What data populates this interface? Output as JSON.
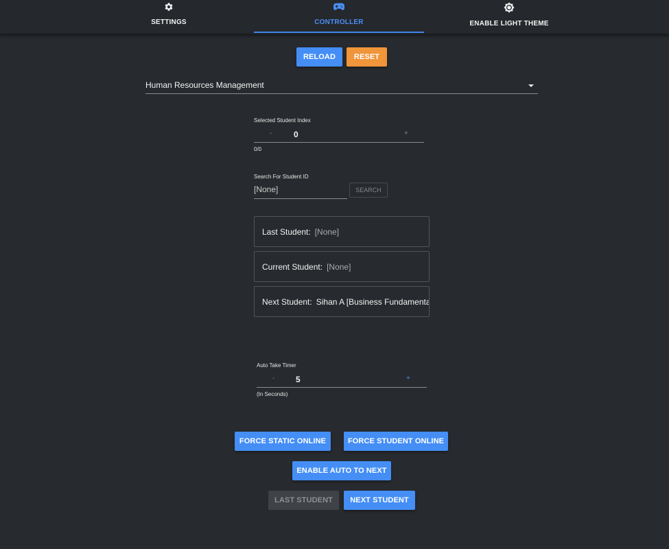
{
  "tabs": [
    {
      "label": "SETTINGS",
      "icon": "gear-icon"
    },
    {
      "label": "CONTROLLER",
      "icon": "gamepad-icon",
      "active": true
    },
    {
      "label": "ENABLE LIGHT THEME",
      "icon": "brightness-icon"
    }
  ],
  "toolbar": {
    "reload_label": "RELOAD",
    "reset_label": "RESET"
  },
  "program_select": {
    "value": "Human Resources Management"
  },
  "student_index": {
    "label": "Selected Student Index",
    "minus": "-",
    "value": "0",
    "plus": "+",
    "count_text": "0/0"
  },
  "search": {
    "label": "Search For Student ID",
    "value": "[None]",
    "button_label": "SEARCH"
  },
  "students": {
    "last_label": "Last Student:",
    "last_value": "[None]",
    "current_label": "Current Student:",
    "current_value": "[None]",
    "next_label": "Next Student:",
    "next_value": "Sihan A [Business Fundamentals]"
  },
  "auto_timer": {
    "label": "Auto Take Timer",
    "minus": "-",
    "value": "5",
    "plus": "+",
    "unit_text": "(In Seconds)"
  },
  "actions": {
    "force_static_label": "FORCE STATIC ONLINE",
    "force_student_label": "FORCE STUDENT ONLINE",
    "auto_next_label": "ENABLE AUTO TO NEXT",
    "last_student_label": "LAST STUDENT",
    "next_student_label": "NEXT STUDENT"
  },
  "colors": {
    "background": "#272a2e",
    "accent_blue": "#448ef6",
    "reset_orange": "#f0953a",
    "disabled": "#3f4347"
  }
}
